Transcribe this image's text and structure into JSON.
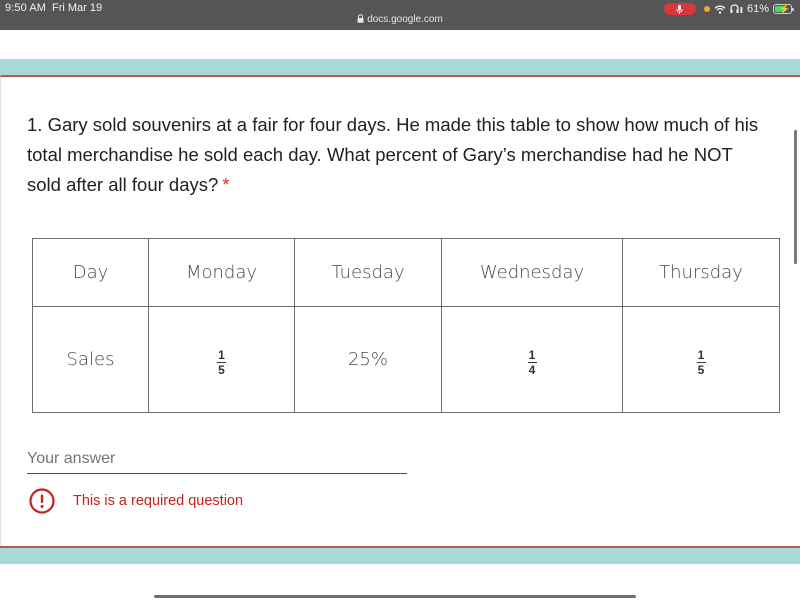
{
  "status_bar": {
    "time": "9:50 AM",
    "date": "Fri Mar 19",
    "battery_percent": "61%",
    "battery_level": 0.61,
    "charging": true,
    "mic_active": true,
    "icons": [
      "microphone-icon",
      "orange-dot-indicator",
      "wifi-icon",
      "headphones-icon",
      "battery-icon"
    ]
  },
  "browser": {
    "url": "docs.google.com",
    "secure": true
  },
  "question": {
    "text": "1. Gary sold souvenirs at a fair for four days. He made this table to show how much of his total merchandise he sold each day. What percent of Gary’s merchandise had he NOT sold after all four days?",
    "required_marker": "*"
  },
  "table": {
    "headers": [
      "Day",
      "Monday",
      "Tuesday",
      "Wednesday",
      "Thursday"
    ],
    "row_label": "Sales",
    "values": [
      {
        "type": "fraction",
        "numerator": "1",
        "denominator": "5"
      },
      {
        "type": "text",
        "text": "25%"
      },
      {
        "type": "fraction",
        "numerator": "1",
        "denominator": "4"
      },
      {
        "type": "fraction",
        "numerator": "1",
        "denominator": "5"
      }
    ]
  },
  "answer": {
    "placeholder": "Your answer",
    "value": ""
  },
  "error": {
    "icon": "error-exclamation-icon",
    "message": "This is a required question"
  },
  "colors": {
    "status_bar_bg": "#555555",
    "teal_bar": "#a7dcd6",
    "error_red": "#c5221f",
    "required_star": "#d93025",
    "mic_red": "#d9363e",
    "battery_green": "#4cd964"
  }
}
